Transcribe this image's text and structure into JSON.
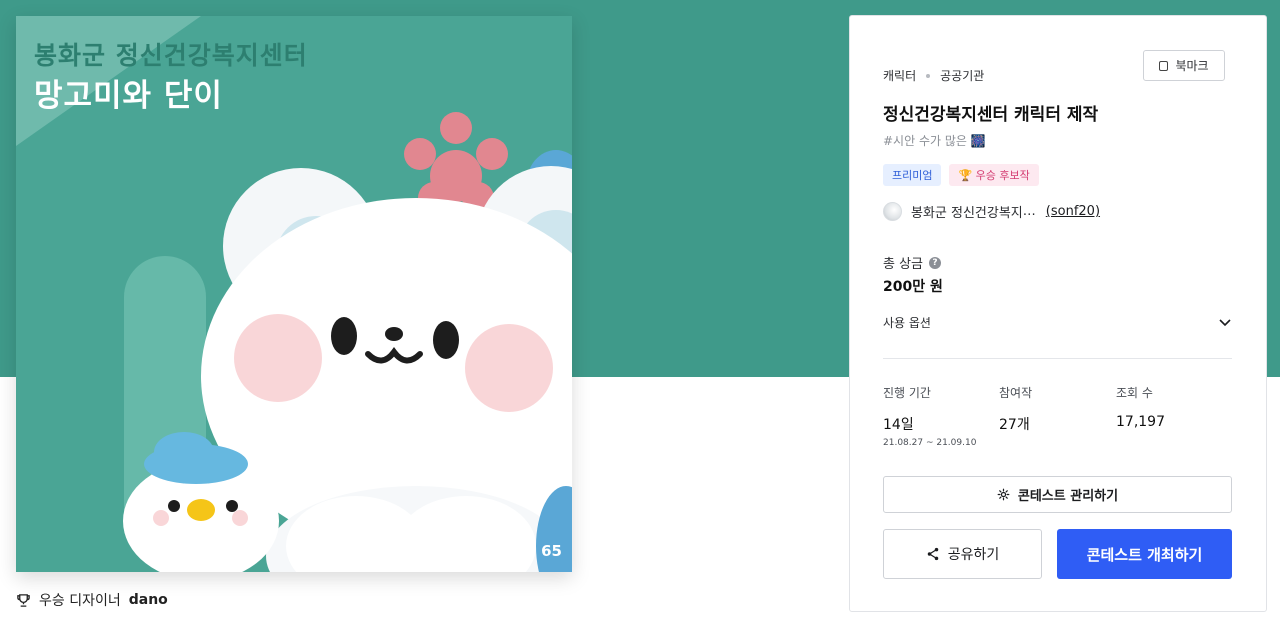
{
  "artwork": {
    "title_line1": "봉화군 정신건강복지센터",
    "title_line2": "망고미와 단이",
    "likes": "65",
    "colors": {
      "background": "#4aa595",
      "title_line1": "#2d7f70"
    }
  },
  "designer": {
    "label": "우승 디자이너",
    "name": "dano",
    "icon": "trophy-icon"
  },
  "contest": {
    "category": "캐릭터",
    "subcategory": "공공기관",
    "bookmark_label": "북마크",
    "title": "정신건강복지센터 캐릭터 제작",
    "hashtag": "#시안 수가 많은 🎆",
    "badges": {
      "premium": "프리미엄",
      "winner": "🏆 우승 후보작"
    },
    "host": {
      "name": "봉화군 정신건강복지",
      "ellipsis": "…",
      "id": "(sonf20)"
    },
    "prize": {
      "label": "총 상금",
      "help": "?",
      "value": "200만 원"
    },
    "usage_label": "사용 옵션",
    "stats": {
      "duration": {
        "label": "진행 기간",
        "value": "14일",
        "range": "21.08.27 ~ 21.09.10"
      },
      "entries": {
        "label": "참여작",
        "value": "27개"
      },
      "views": {
        "label": "조회 수",
        "value": "17,197"
      }
    },
    "buttons": {
      "manage": "콘테스트 관리하기",
      "share": "공유하기",
      "host": "콘테스트 개최하기"
    },
    "colors": {
      "primary": "#2f5df5",
      "hero": "#3f9a8a"
    }
  }
}
